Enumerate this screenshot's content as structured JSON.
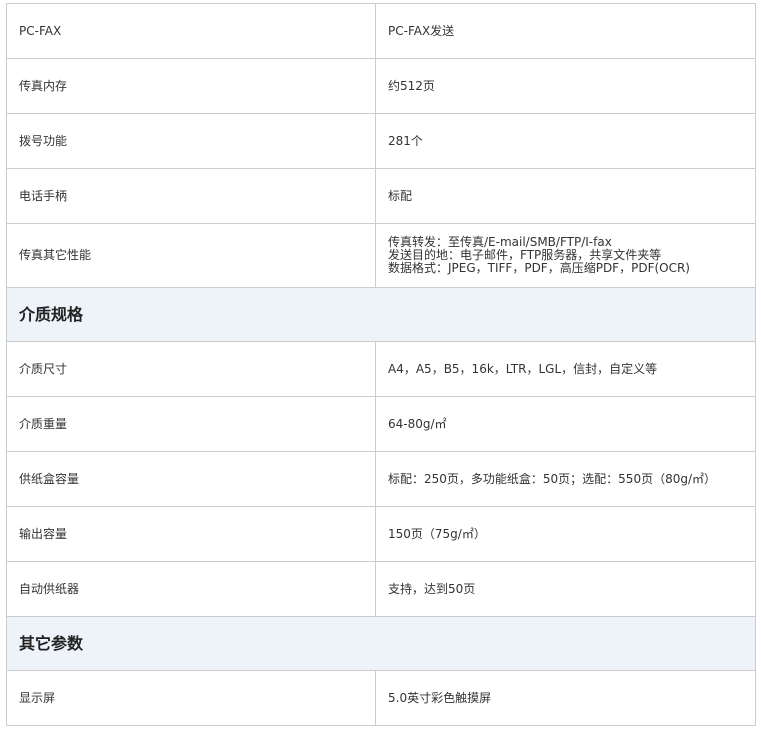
{
  "rows": [
    {
      "label": "PC-FAX",
      "value": "PC-FAX发送"
    },
    {
      "label": "传真内存",
      "value": "约512页"
    },
    {
      "label": "拨号功能",
      "value": "281个"
    },
    {
      "label": "电话手柄",
      "value": "标配"
    },
    {
      "label": "传真其它性能",
      "value_lines": [
        "传真转发：至传真/E-mail/SMB/FTP/I-fax",
        "发送目的地：电子邮件，FTP服务器，共享文件夹等",
        "数据格式：JPEG，TIFF，PDF，高压缩PDF，PDF(OCR)"
      ]
    },
    {
      "section": "介质规格"
    },
    {
      "label": "介质尺寸",
      "value": "A4，A5，B5，16k，LTR，LGL，信封，自定义等"
    },
    {
      "label": "介质重量",
      "value": "64-80g/㎡"
    },
    {
      "label": "供纸盒容量",
      "value": "标配：250页，多功能纸盒：50页；选配：550页（80g/㎡）"
    },
    {
      "label": "输出容量",
      "value": "150页（75g/㎡）"
    },
    {
      "label": "自动供纸器",
      "value": "支持，达到50页"
    },
    {
      "section": "其它参数"
    },
    {
      "label": "显示屏",
      "value": "5.0英寸彩色触摸屏"
    }
  ]
}
